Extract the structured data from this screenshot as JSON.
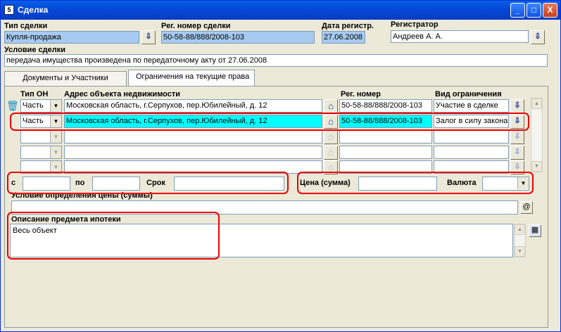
{
  "window": {
    "title": "Сделка",
    "title_icon": "app-icon",
    "buttons": {
      "minimize": "_",
      "maximize": "□",
      "close": "X"
    }
  },
  "header": {
    "deal_type_label": "Тип сделки",
    "deal_type_value": "Купля-продажа",
    "reg_number_label": "Рег. номер сделки",
    "reg_number_value": "50-58-88/888/2008-103",
    "reg_date_label": "Дата регистр.",
    "reg_date_value": "27.06.2008",
    "registrar_label": "Регистратор",
    "registrar_value": "Андреев А. А.",
    "condition_label": "Условие сделки",
    "condition_value": "передача имущества произведена по передаточному акту от 27.06.2008"
  },
  "tabs": [
    {
      "label": "Документы и Участники",
      "active": false
    },
    {
      "label": "Ограничения на текущие права",
      "active": true
    }
  ],
  "grid": {
    "col_type": "Тип ОН",
    "col_address": "Адрес объекта недвижимости",
    "col_regnum": "Рег. номер",
    "col_restriction": "Вид ограничения",
    "rows": [
      {
        "type": "Часть",
        "address": "Московская область, г.Серпухов, пер.Юбилейный, д. 12",
        "regnum": "50-58-88/888/2008-103",
        "restriction": "Участие в сделке",
        "selected": false
      },
      {
        "type": "Часть",
        "address": "Московская область, г.Серпухов, пер.Юбилейный, д. 12",
        "regnum": "50-58-88/888/2008-103",
        "restriction": "Залог в силу закона",
        "selected": true
      },
      {
        "type": "",
        "address": "",
        "regnum": "",
        "restriction": "",
        "selected": false
      },
      {
        "type": "",
        "address": "",
        "regnum": "",
        "restriction": "",
        "selected": false
      },
      {
        "type": "",
        "address": "",
        "regnum": "",
        "restriction": "",
        "selected": false
      }
    ]
  },
  "period": {
    "from_label": "с",
    "from_value": "",
    "to_label": "по",
    "to_value": "",
    "term_label": "Срок",
    "term_value": ""
  },
  "price": {
    "price_label": "Цена (сумма)",
    "price_value": "",
    "currency_label": "Валюта",
    "currency_value": ""
  },
  "price_condition": {
    "label": "Условие определения цены (суммы)",
    "value": "",
    "at_button": "@"
  },
  "mortgage": {
    "label": "Описание предмета ипотеки",
    "value": "Весь объект"
  },
  "colors": {
    "selected_row": "#00ffff",
    "readonly_field": "#a6caf0",
    "highlight": "#e00000",
    "title_bar": "#0a5fe8"
  }
}
